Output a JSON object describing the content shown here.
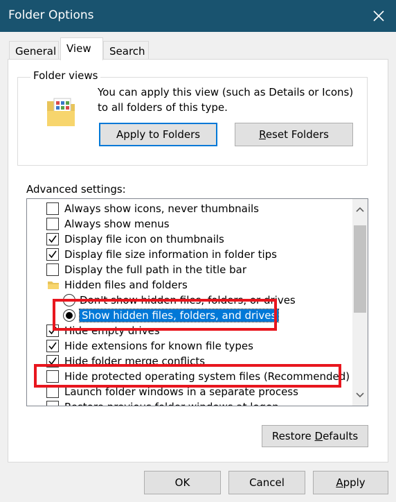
{
  "window": {
    "title": "Folder Options"
  },
  "tabs": [
    {
      "label": "General"
    },
    {
      "label": "View"
    },
    {
      "label": "Search"
    }
  ],
  "folder_views": {
    "legend": "Folder views",
    "description": "You can apply this view (such as Details or Icons) to all folders of this type.",
    "apply_button": "Apply to Folders",
    "reset_button_prefix": "",
    "reset_button_mnemonic": "R",
    "reset_button_rest": "eset Folders"
  },
  "advanced": {
    "label": "Advanced settings:",
    "items": [
      {
        "label": "Always show icons, never thumbnails",
        "type": "checkbox",
        "checked": false
      },
      {
        "label": "Always show menus",
        "type": "checkbox",
        "checked": false
      },
      {
        "label": "Display file icon on thumbnails",
        "type": "checkbox",
        "checked": true
      },
      {
        "label": "Display file size information in folder tips",
        "type": "checkbox",
        "checked": true
      },
      {
        "label": "Display the full path in the title bar",
        "type": "checkbox",
        "checked": false
      },
      {
        "label": "Hidden files and folders",
        "type": "folder",
        "checked": false
      },
      {
        "label": "Don't show hidden files, folders, or drives",
        "type": "radio",
        "checked": false
      },
      {
        "label": "Show hidden files, folders, and drives",
        "type": "radio",
        "checked": true
      },
      {
        "label": "Hide empty drives",
        "type": "checkbox",
        "checked": true
      },
      {
        "label": "Hide extensions for known file types",
        "type": "checkbox",
        "checked": true
      },
      {
        "label": "Hide folder merge conflicts",
        "type": "checkbox",
        "checked": true
      },
      {
        "label": "Hide protected operating system files (Recommended)",
        "type": "checkbox",
        "checked": false
      },
      {
        "label": "Launch folder windows in a separate process",
        "type": "checkbox",
        "checked": false
      },
      {
        "label": "Restore previous folder windows at logon",
        "type": "checkbox",
        "checked": false
      }
    ]
  },
  "restore_defaults": {
    "prefix": "Restore ",
    "mnemonic": "D",
    "rest": "efaults"
  },
  "footer": {
    "ok": "OK",
    "cancel": "Cancel",
    "apply_mnemonic": "A",
    "apply_rest": "pply"
  },
  "colors": {
    "titlebar": "#19536f",
    "selection": "#0078d7",
    "annotation": "#e8161e"
  },
  "icons": [
    "close-icon",
    "folder-views-icon",
    "folder-icon",
    "check-icon",
    "scroll-up-icon",
    "scroll-down-icon"
  ]
}
